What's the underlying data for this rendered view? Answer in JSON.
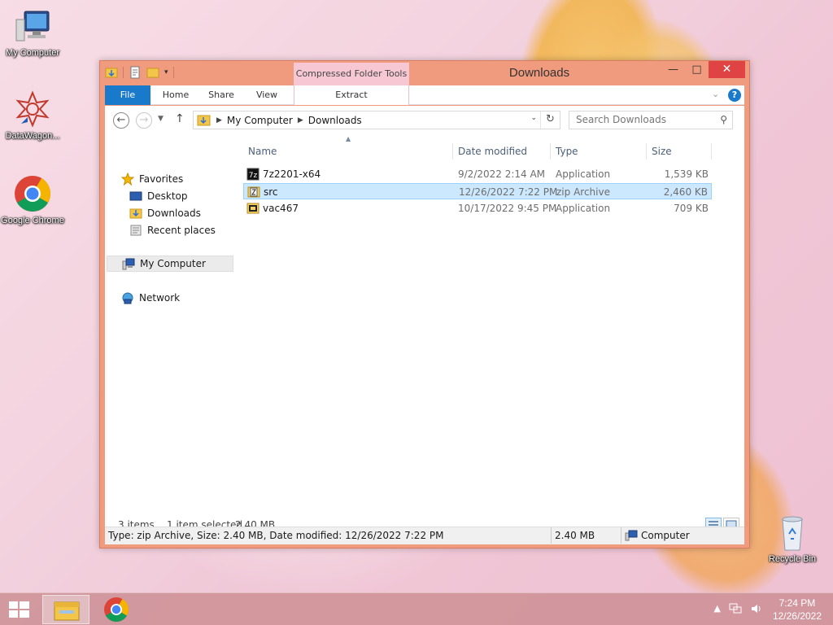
{
  "desktop": {
    "icons": [
      {
        "label": "My Computer"
      },
      {
        "label": "DataWagon..."
      },
      {
        "label": "Google Chrome"
      },
      {
        "label": "Recycle Bin"
      }
    ]
  },
  "window": {
    "title": "Downloads",
    "context_tab_group": "Compressed Folder Tools",
    "ribbon_tabs": {
      "file": "File",
      "home": "Home",
      "share": "Share",
      "view": "View",
      "extract": "Extract"
    },
    "address": {
      "crumbs": [
        "My Computer",
        "Downloads"
      ]
    },
    "search": {
      "placeholder": "Search Downloads"
    },
    "nav_pane": {
      "favorites": "Favorites",
      "desktop": "Desktop",
      "downloads": "Downloads",
      "recent_places": "Recent places",
      "my_computer": "My Computer",
      "network": "Network"
    },
    "columns": {
      "name": "Name",
      "date_modified": "Date modified",
      "type": "Type",
      "size": "Size"
    },
    "files": [
      {
        "name": "7z2201-x64",
        "date": "9/2/2022 2:14 AM",
        "type": "Application",
        "size": "1,539 KB",
        "selected": false,
        "icon": "7zip-installer-icon"
      },
      {
        "name": "src",
        "date": "12/26/2022 7:22 PM",
        "type": "zip Archive",
        "size": "2,460 KB",
        "selected": true,
        "icon": "zip-archive-icon"
      },
      {
        "name": "vac467",
        "date": "10/17/2022 9:45 PM",
        "type": "Application",
        "size": "709 KB",
        "selected": false,
        "icon": "application-icon"
      }
    ],
    "status": {
      "items": "3 items",
      "selected": "1 item selected",
      "selected_size": "2.40 MB"
    },
    "details_bar": {
      "info": "Type: zip Archive, Size: 2.40 MB, Date modified: 12/26/2022 7:22 PM",
      "size": "2.40 MB",
      "location": "Computer"
    }
  },
  "taskbar": {
    "clock_time": "7:24 PM",
    "clock_date": "12/26/2022"
  },
  "colors": {
    "window_frame": "#f09a7e",
    "file_tab": "#1979ca",
    "context_tab": "#f7c8d3",
    "selection": "#cce8ff",
    "close_button": "#e04343"
  }
}
